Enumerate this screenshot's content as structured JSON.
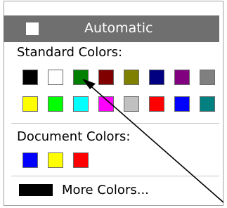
{
  "automatic": {
    "label": "Automatic",
    "swatch_color": "#ffffff",
    "highlight_color": "#6f6f6f"
  },
  "standard": {
    "title": "Standard Colors:",
    "colors": [
      "#000000",
      "#ffffff",
      "#008000",
      "#800000",
      "#808000",
      "#000080",
      "#800080",
      "#808080",
      "#ffff00",
      "#00ff00",
      "#00ffff",
      "#ff00ff",
      "#c0c0c0",
      "#ff0000",
      "#0000ff",
      "#008080"
    ]
  },
  "document": {
    "title": "Document Colors:",
    "colors": [
      "#0000ff",
      "#ffff00",
      "#ff0000"
    ]
  },
  "more_colors": {
    "label": "More Colors...",
    "swatch_color": "#000000"
  }
}
